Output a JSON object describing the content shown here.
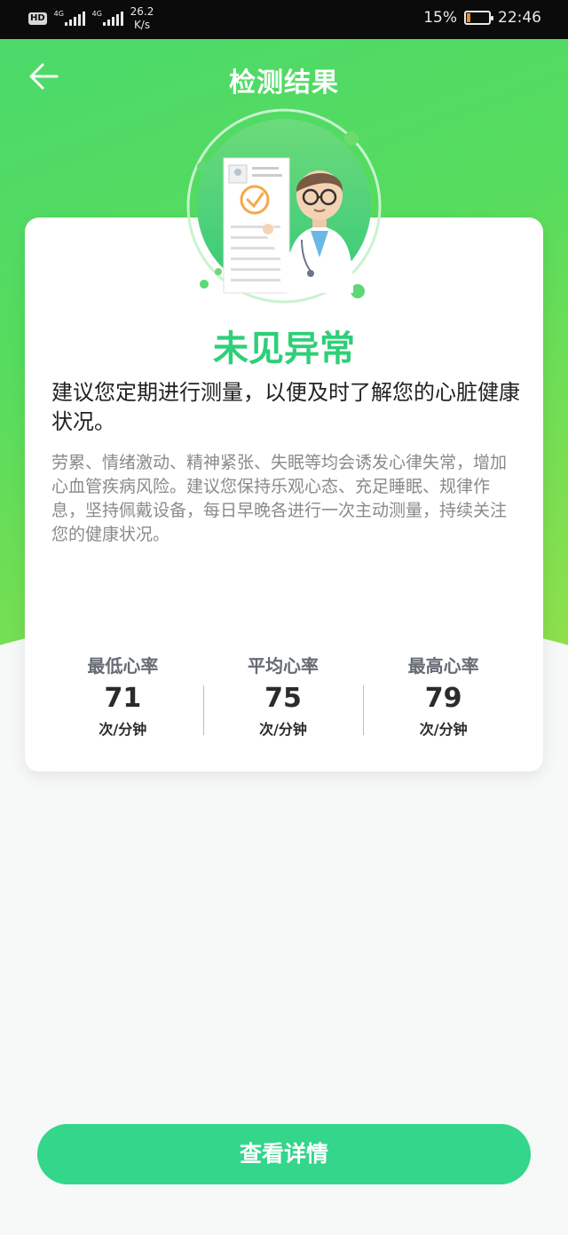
{
  "status_bar": {
    "hd": "HD",
    "signal1_tag": "4G",
    "signal2_tag": "4G",
    "net_speed_value": "26.2",
    "net_speed_unit": "K/s",
    "battery_percent": "15%",
    "time": "22:46"
  },
  "header": {
    "title": "检测结果"
  },
  "result": {
    "title": "未见异常",
    "advice": "建议您定期进行测量，以便及时了解您的心脏健康状况。",
    "detail": "劳累、情绪激动、精神紧张、失眠等均会诱发心律失常，增加心血管疾病风险。建议您保持乐观心态、充足睡眠、规律作息，坚持佩戴设备，每日早晚各进行一次主动测量，持续关注您的健康状况。"
  },
  "stats": [
    {
      "label": "最低心率",
      "value": "71",
      "unit": "次/分钟"
    },
    {
      "label": "平均心率",
      "value": "75",
      "unit": "次/分钟"
    },
    {
      "label": "最高心率",
      "value": "79",
      "unit": "次/分钟"
    }
  ],
  "actions": {
    "view_details": "查看详情"
  },
  "colors": {
    "header_gradient_start": "#4cd96a",
    "header_gradient_end": "#8fe04a",
    "result_green": "#2ecf78",
    "button_green": "#33d68b"
  }
}
